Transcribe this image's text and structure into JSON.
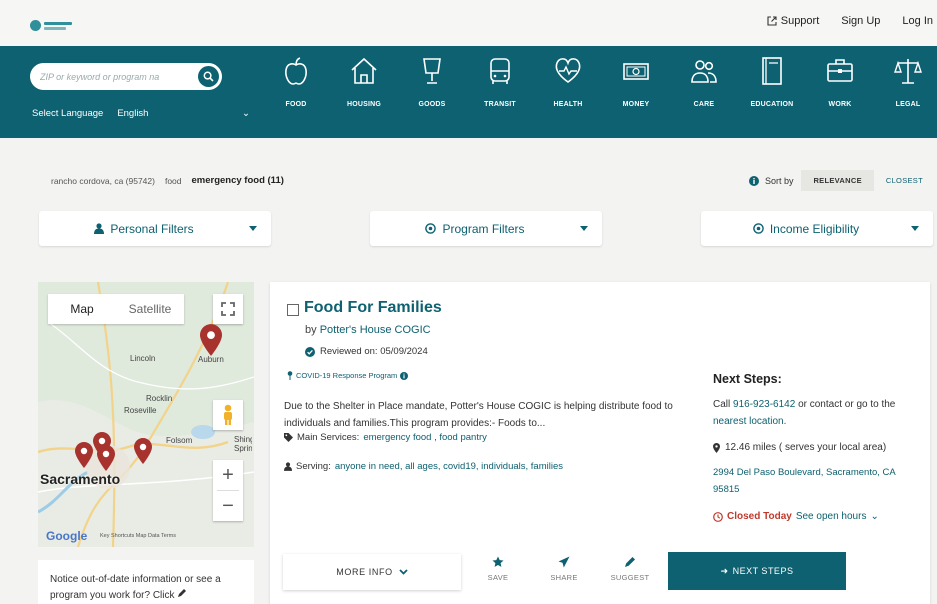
{
  "header": {
    "links": [
      {
        "label": "Support",
        "icon": "external-link-icon"
      },
      {
        "label": "Sign Up"
      },
      {
        "label": "Log In"
      }
    ]
  },
  "nav": {
    "search_placeholder": "ZIP or keyword or program na",
    "language_label": "Select Language",
    "language_value": "English",
    "categories": [
      {
        "label": "FOOD",
        "icon": "apple-icon"
      },
      {
        "label": "HOUSING",
        "icon": "house-icon"
      },
      {
        "label": "GOODS",
        "icon": "lamp-icon"
      },
      {
        "label": "TRANSIT",
        "icon": "bus-icon"
      },
      {
        "label": "HEALTH",
        "icon": "heartbeat-icon"
      },
      {
        "label": "MONEY",
        "icon": "money-icon"
      },
      {
        "label": "CARE",
        "icon": "people-icon"
      },
      {
        "label": "EDUCATION",
        "icon": "book-icon"
      },
      {
        "label": "WORK",
        "icon": "briefcase-icon"
      },
      {
        "label": "LEGAL",
        "icon": "scales-icon"
      }
    ]
  },
  "breadcrumb": {
    "location": "rancho cordova, ca (95742)",
    "category": "food",
    "current": "emergency food (11)"
  },
  "sort": {
    "label": "Sort by",
    "options": [
      "RELEVANCE",
      "CLOSEST"
    ],
    "selected": "RELEVANCE"
  },
  "filters": [
    {
      "label": "Personal Filters",
      "icon": "person-icon"
    },
    {
      "label": "Program Filters",
      "icon": "target-icon"
    },
    {
      "label": "Income Eligibility",
      "icon": "target-icon"
    }
  ],
  "map": {
    "tabs": [
      "Map",
      "Satellite"
    ],
    "selected_tab": "Map",
    "places": [
      "Lincoln",
      "Auburn",
      "Rocklin",
      "Roseville",
      "Folsom",
      "Shingle Springs",
      "Sacramento"
    ],
    "google": "Google",
    "attribution": "Key Shortcuts  Map Data  Terms",
    "zoom_in": "+",
    "zoom_out": "−"
  },
  "notice": {
    "text": "Notice out-of-date information or see a program you work for? Click"
  },
  "program": {
    "title": "Food For Families",
    "by_label": "by",
    "provider": "Potter's House COGIC",
    "reviewed": "Reviewed on: 05/09/2024",
    "covid_tag": "COVID-19 Response Program",
    "description": "Due to the Shelter in Place mandate, Potter's House COGIC is helping distribute food to individuals and families.This program provides:- Foods to...",
    "main_services_label": "Main Services:",
    "main_services": "emergency food , food pantry",
    "serving_label": "Serving:",
    "serving": "anyone in need, all ages, covid19, individuals, families",
    "next_steps": {
      "heading": "Next Steps:",
      "call_prefix": "Call",
      "phone": "916-923-6142",
      "call_suffix": "or contact or go to the",
      "nearest": "nearest location.",
      "distance": "12.46 miles ( serves your local area)",
      "address": "2994 Del Paso Boulevard, Sacramento, CA 95815",
      "closed": "Closed Today",
      "open_hours": "See open hours"
    },
    "actions": {
      "more_info": "MORE INFO",
      "save": "SAVE",
      "share": "SHARE",
      "suggest": "SUGGEST",
      "next_steps": "NEXT STEPS"
    }
  },
  "colors": {
    "brand": "#0e6170",
    "closed": "#c0392b",
    "pin": "#a8322e"
  }
}
